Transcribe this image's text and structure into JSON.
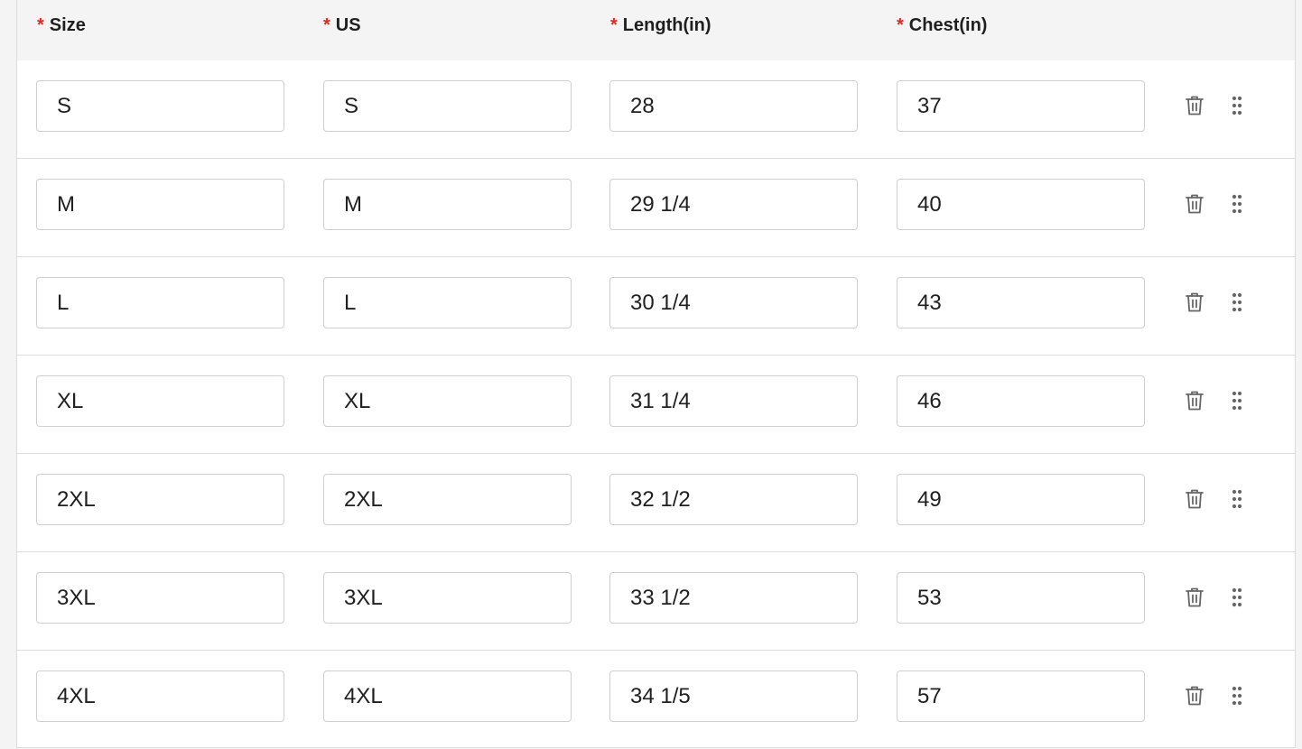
{
  "table": {
    "columns": [
      {
        "required_mark": "*",
        "label": "Size"
      },
      {
        "required_mark": "*",
        "label": "US"
      },
      {
        "required_mark": "*",
        "label": "Length(in)"
      },
      {
        "required_mark": "*",
        "label": "Chest(in)"
      }
    ],
    "rows": [
      {
        "size": "S",
        "us": "S",
        "length": "28",
        "chest": "37"
      },
      {
        "size": "M",
        "us": "M",
        "length": "29 1/4",
        "chest": "40"
      },
      {
        "size": "L",
        "us": "L",
        "length": "30 1/4",
        "chest": "43"
      },
      {
        "size": "XL",
        "us": "XL",
        "length": "31 1/4",
        "chest": "46"
      },
      {
        "size": "2XL",
        "us": "2XL",
        "length": "32 1/2",
        "chest": "49"
      },
      {
        "size": "3XL",
        "us": "3XL",
        "length": "33 1/2",
        "chest": "53"
      },
      {
        "size": "4XL",
        "us": "4XL",
        "length": "34 1/5",
        "chest": "57"
      }
    ],
    "row_actions": {
      "delete_icon": "trash-icon",
      "drag_icon": "drag-handle-icon"
    }
  },
  "colors": {
    "required_mark": "#e3271b",
    "header_bg": "#f4f4f4",
    "border": "#dcdcdc",
    "icon": "#666666"
  }
}
